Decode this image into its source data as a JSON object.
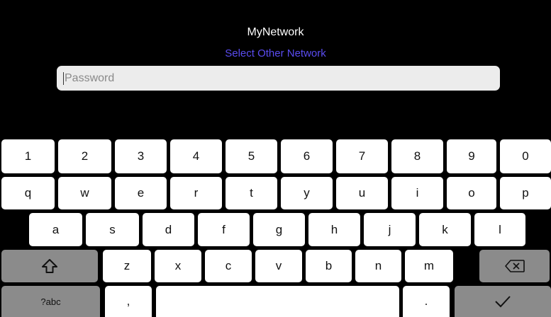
{
  "network": {
    "name": "MyNetwork",
    "select_other": "Select Other Network"
  },
  "password_field": {
    "placeholder": "Password",
    "value": ""
  },
  "keyboard": {
    "row_numbers": [
      "1",
      "2",
      "3",
      "4",
      "5",
      "6",
      "7",
      "8",
      "9",
      "0"
    ],
    "row_top": [
      "q",
      "w",
      "e",
      "r",
      "t",
      "y",
      "u",
      "i",
      "o",
      "p"
    ],
    "row_home": [
      "a",
      "s",
      "d",
      "f",
      "g",
      "h",
      "j",
      "k",
      "l"
    ],
    "row_bottom": [
      "z",
      "x",
      "c",
      "v",
      "b",
      "n",
      "m"
    ],
    "mode_key": "?abc",
    "comma_key": ",",
    "period_key": ".",
    "shift_icon": "shift-icon",
    "backspace_icon": "backspace-icon",
    "enter_icon": "checkmark-icon"
  }
}
